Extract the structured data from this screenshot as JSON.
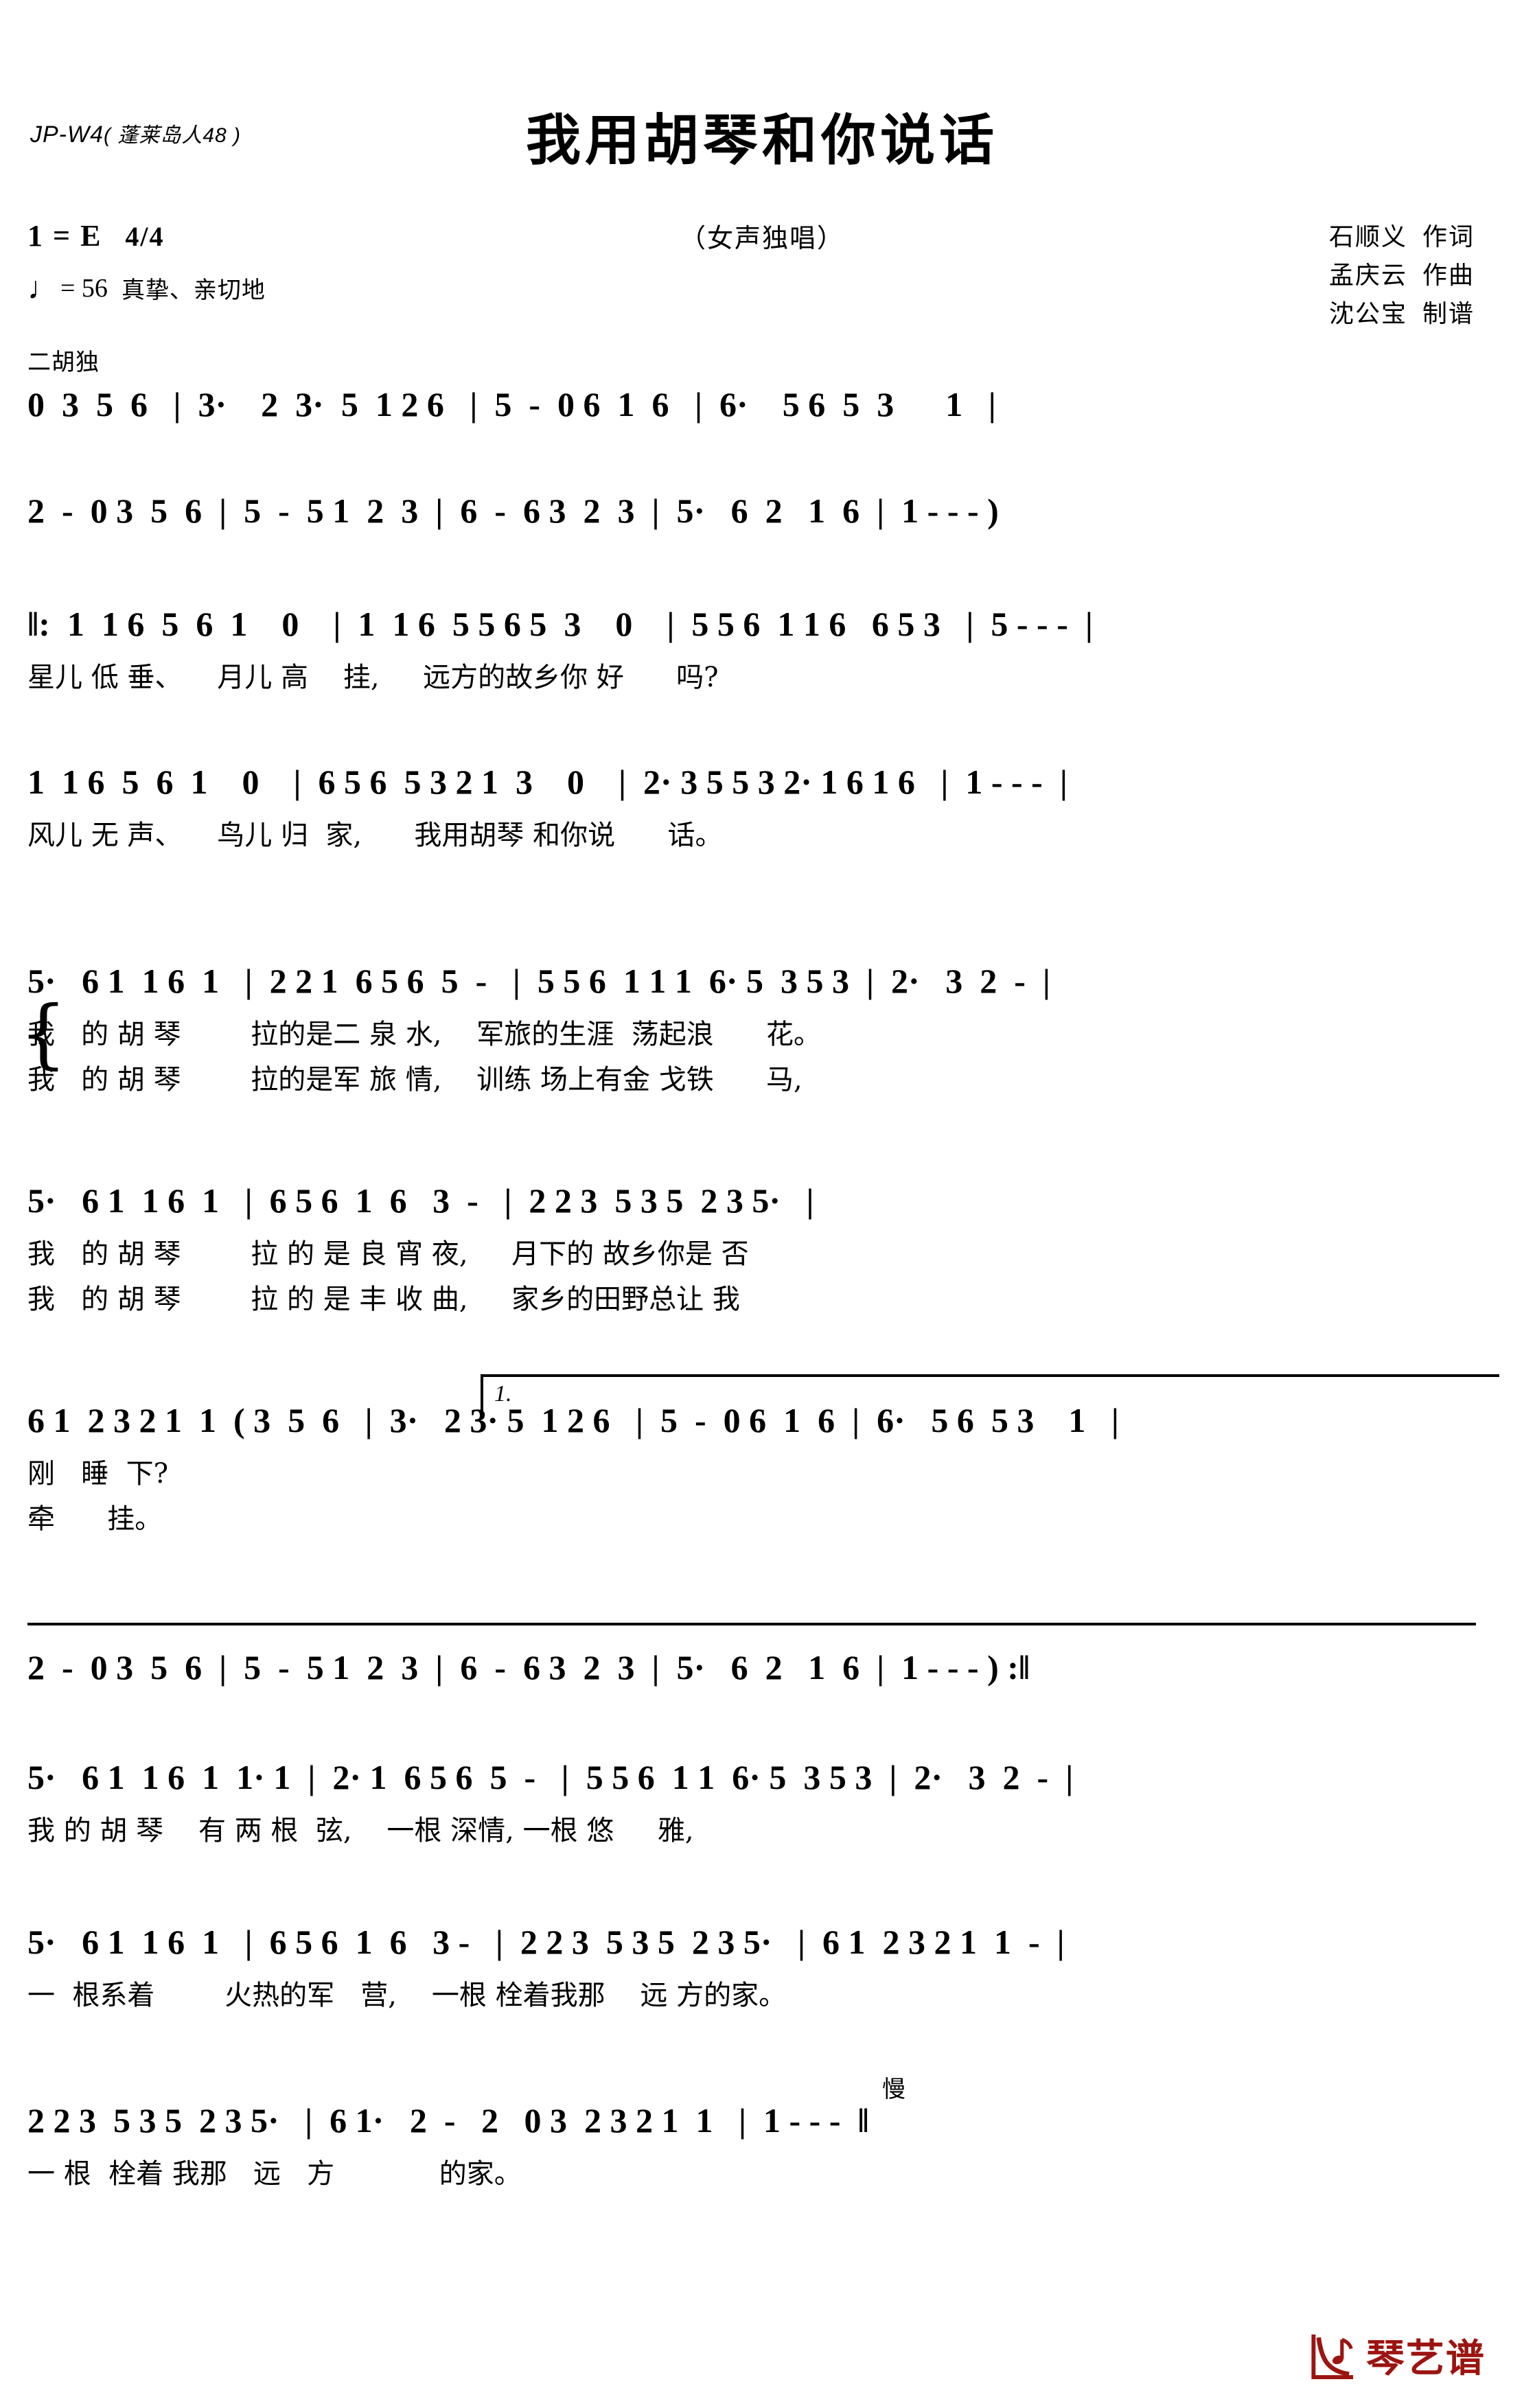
{
  "header": {
    "catalog_id": "JP-W4",
    "catalog_paren": "( 蓬莱岛人48 )",
    "title": "我用胡琴和你说话",
    "subtitle": "（女声独唱）",
    "key_label": "1 = E",
    "meter": "4/4",
    "tempo": "= 56",
    "mood": "真挚、亲切地",
    "credits": [
      {
        "name": "石顺义",
        "role": "作词"
      },
      {
        "name": "孟庆云",
        "role": "作曲"
      },
      {
        "name": "沈公宝",
        "role": "制谱"
      }
    ],
    "instrument_note": "二胡独"
  },
  "systems": [
    {
      "id": "intro-1",
      "notes": "0  3  5  6   |  3·    2  3·  5  1 2 6   |  5  -  0 6  1  6   |  6·    5 6  5  3      1   |",
      "lyrics": []
    },
    {
      "id": "intro-2",
      "notes": "2  -  0 3  5  6  |  5  -  5 1  2  3  |  6  -  6 3  2  3  |  5·   6  2   1  6  |  1 - - - )",
      "lyrics": []
    },
    {
      "id": "verse-a1",
      "notes": "‖:  1  1 6  5  6  1    0    |  1  1 6  5 5 6 5  3    0    |  5 5 6  1 1 6   6 5 3   |  5 - - -  |",
      "lyrics": [
        "星儿 低 垂、    月儿 高    挂,     远方的故乡你 好      吗?"
      ]
    },
    {
      "id": "verse-a2",
      "notes": "1  1 6  5  6  1    0    |  6 5 6  5 3 2 1  3    0    |  2· 3 5 5 3 2· 1 6 1 6   |  1 - - -  |",
      "lyrics": [
        "风儿 无 声、    鸟儿 归  家,      我用胡琴 和你说      话。"
      ]
    },
    {
      "id": "verse-b",
      "notes": "5·   6 1  1 6  1   |  2 2 1  6 5 6  5  -   |  5 5 6  1 1 1  6· 5  3 5 3  |  2·   3  2  -  |",
      "lyrics": [
        "我   的 胡 琴        拉的是二 泉 水,    军旅的生涯  荡起浪      花。",
        "我   的 胡 琴        拉的是军 旅 情,    训练 场上有金 戈铁      马,"
      ]
    },
    {
      "id": "verse-c",
      "notes": "5·   6 1  1 6  1   |  6 5 6  1  6   3  -   |  2 2 3  5 3 5  2 3 5·   |",
      "lyrics": [
        "我   的 胡 琴        拉 的 是 良 宵 夜,     月下的 故乡你是 否",
        "我   的 胡 琴        拉 的 是 丰 收 曲,     家乡的田野总让 我"
      ]
    },
    {
      "id": "verse-d",
      "notes": "6 1  2 3 2 1  1  ( 3  5  6   |  3·   2 3· 5  1 2 6   |  5  -  0 6  1  6  |  6·   5 6  5 3    1   |",
      "lyrics": [
        "刚   睡  下?",
        "牵      挂。"
      ],
      "ending_label": "1."
    },
    {
      "id": "verse-e",
      "notes": "2  -  0 3  5  6  |  5  -  5 1  2  3  |  6  -  6 3  2  3  |  5·   6  2   1  6  |  1 - - - ) :‖",
      "lyrics": []
    },
    {
      "id": "verse-f",
      "notes": "5·   6 1  1 6  1  1· 1  |  2· 1  6 5 6  5  -   |  5 5 6  1 1  6· 5  3 5 3  |  2·   3  2  -  |",
      "lyrics": [
        "我 的 胡 琴    有 两 根  弦,    一根 深情, 一根 悠     雅,"
      ]
    },
    {
      "id": "verse-g",
      "notes": "5·   6 1  1 6  1   |  6 5 6  1  6   3 -   |  2 2 3  5 3 5  2 3 5·   |  6 1  2 3 2 1  1  -  |",
      "lyrics": [
        "一  根系着        火热的军   营,    一根 栓着我那    远 方的家。"
      ]
    },
    {
      "id": "verse-h",
      "notes": "2 2 3  5 3 5  2 3 5·   |  6 1·   2  -   2   0 3  2 3 2 1  1   |  1 - - -  ‖",
      "lyrics": [
        "一 根  栓着 我那   远   方            的家。"
      ],
      "slow_mark": "慢"
    }
  ],
  "logo": {
    "text": "琴艺谱",
    "color": "#9c1410"
  }
}
